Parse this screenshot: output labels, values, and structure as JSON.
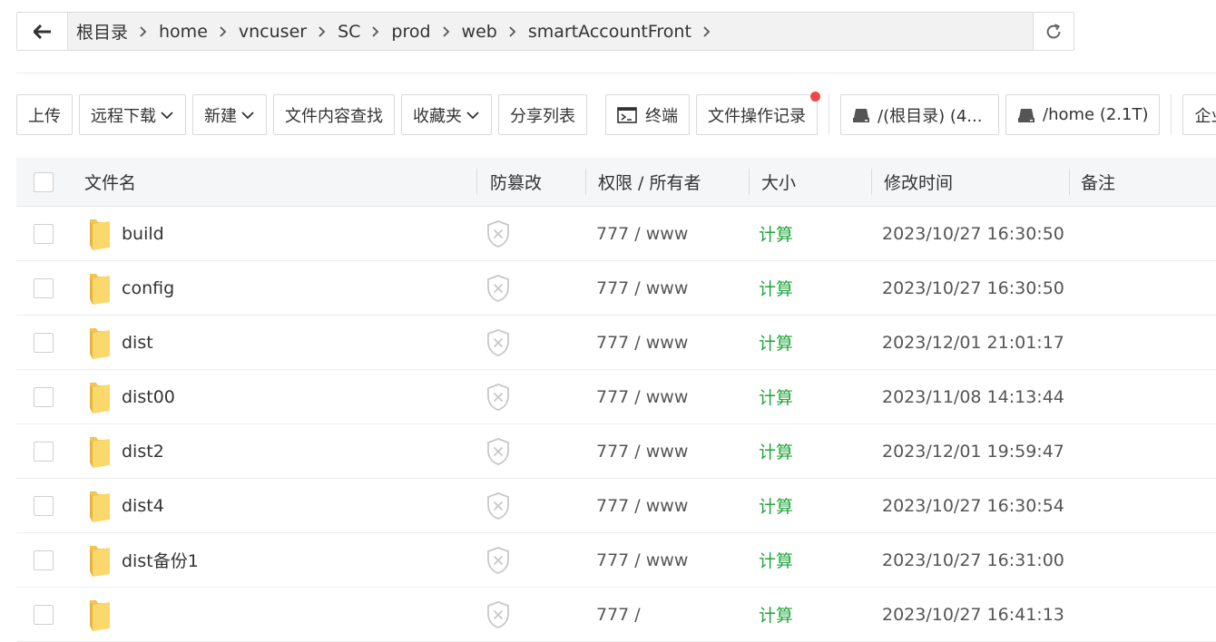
{
  "breadcrumb": {
    "segments": [
      "根目录",
      "home",
      "vncuser",
      "SC",
      "prod",
      "web",
      "smartAccountFront"
    ]
  },
  "toolbar": {
    "upload": "上传",
    "remote_download": "远程下载",
    "new": "新建",
    "search_content": "文件内容查找",
    "favorites": "收藏夹",
    "share_list": "分享列表",
    "terminal": "终端",
    "operation_log": "文件操作记录",
    "disk_root": "/(根目录) (4...",
    "disk_home": "/home (2.1T)",
    "enterprise": "企业"
  },
  "table": {
    "headers": {
      "name": "文件名",
      "tamper": "防篡改",
      "perm": "权限 / 所有者",
      "size": "大小",
      "mtime": "修改时间",
      "note": "备注"
    },
    "rows": [
      {
        "name": "build",
        "perm": "777 / www",
        "size": "计算",
        "mtime": "2023/10/27 16:30:50"
      },
      {
        "name": "config",
        "perm": "777 / www",
        "size": "计算",
        "mtime": "2023/10/27 16:30:50"
      },
      {
        "name": "dist",
        "perm": "777 / www",
        "size": "计算",
        "mtime": "2023/12/01 21:01:17"
      },
      {
        "name": "dist00",
        "perm": "777 / www",
        "size": "计算",
        "mtime": "2023/11/08 14:13:44"
      },
      {
        "name": "dist2",
        "perm": "777 / www",
        "size": "计算",
        "mtime": "2023/12/01 19:59:47"
      },
      {
        "name": "dist4",
        "perm": "777 / www",
        "size": "计算",
        "mtime": "2023/10/27 16:30:54"
      },
      {
        "name": "dist备份1",
        "perm": "777 / www",
        "size": "计算",
        "mtime": "2023/10/27 16:31:00"
      },
      {
        "name": "",
        "perm": "777 /",
        "size": "计算",
        "mtime": "2023/10/27 16:41:13"
      }
    ]
  },
  "colors": {
    "accent_green": "#20a53a",
    "notification_red": "#ef4848"
  },
  "icons": {
    "back": "arrow-left-icon",
    "refresh": "refresh-icon",
    "separator": "chevron-right-icon",
    "folder": "folder-icon",
    "tamper": "shield-x-icon",
    "terminal": "terminal-icon",
    "disk": "disk-icon"
  }
}
